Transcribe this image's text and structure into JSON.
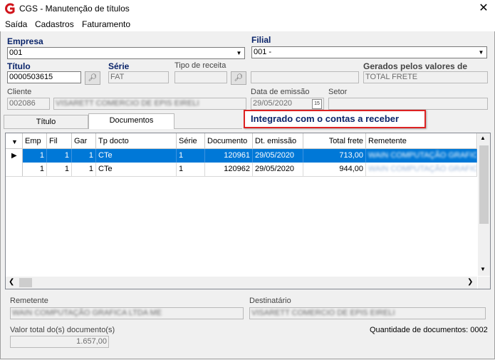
{
  "window": {
    "title": "CGS - Manutenção de títulos",
    "close_label": "✕"
  },
  "menu": [
    "Saída",
    "Cadastros",
    "Faturamento"
  ],
  "form": {
    "empresa_label": "Empresa",
    "empresa_value": "001",
    "filial_label": "Filial",
    "filial_value": "001 -",
    "titulo_label": "Título",
    "titulo_value": "0000503615",
    "serie_label": "Série",
    "serie_value": "FAT",
    "tipo_receita_label": "Tipo de receita",
    "tipo_receita_value": "",
    "gerados_label": "Gerados pelos valores de",
    "gerados_value": "TOTAL FRETE",
    "cliente_label": "Cliente",
    "cliente_code": "002086",
    "cliente_name": "VISARETT COMERCIO DE EPIS EIRELI",
    "data_emissao_label": "Data de emissão",
    "data_emissao_value": "29/05/2020",
    "calendar_label": "15",
    "setor_label": "Setor",
    "setor_value": ""
  },
  "tabs": [
    {
      "label": "Título"
    },
    {
      "label": "Documentos"
    }
  ],
  "notice": "Integrado com o contas a receber",
  "grid": {
    "headers": [
      "Emp",
      "Fil",
      "Gar",
      "Tp docto",
      "Série",
      "Documento",
      "Dt. emissão",
      "Total frete",
      "Remetente"
    ],
    "rows": [
      {
        "emp": "1",
        "fil": "1",
        "gar": "1",
        "tp": "CTe",
        "serie": "1",
        "doc": "120961",
        "dt": "29/05/2020",
        "total": "713,00",
        "rem": "WAIN COMPUTAÇÃO GRAFICA LTDA ME"
      },
      {
        "emp": "1",
        "fil": "1",
        "gar": "1",
        "tp": "CTe",
        "serie": "1",
        "doc": "120962",
        "dt": "29/05/2020",
        "total": "944,00",
        "rem": "WAIN COMPUTAÇÃO GRAFICA LTDA ME"
      }
    ]
  },
  "footer": {
    "remetente_label": "Remetente",
    "remetente_value": "WAIN COMPUTAÇÃO GRAFICA LTDA ME",
    "destinatario_label": "Destinatário",
    "destinatario_value": "VISARETT COMERCIO DE EPIS EIRELI",
    "valor_total_label": "Valor total do(s) documento(s)",
    "valor_total_value": "1.657,00",
    "qtd_label": "Quantidade de documentos:",
    "qtd_value": "0002"
  }
}
